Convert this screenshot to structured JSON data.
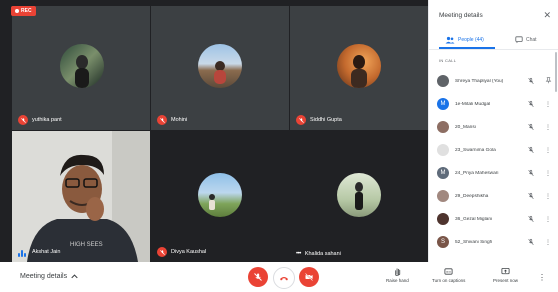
{
  "recording": {
    "label": "REC"
  },
  "tiles": [
    {
      "name": "yuthika pant"
    },
    {
      "name": "Mohini"
    },
    {
      "name": "Siddhi Gupta"
    },
    {
      "name": "Akshat Jain"
    },
    {
      "name": "Divya Kaushal"
    },
    {
      "name": "Khalida sahani"
    }
  ],
  "panel": {
    "title": "Meeting details",
    "tabs": {
      "people": "People (44)",
      "chat": "Chat"
    },
    "section_label": "IN CALL",
    "people": [
      {
        "name": "Shreya Thapliyal (You)",
        "initial": "",
        "color": "#5f6368"
      },
      {
        "name": "1e-Mitali Mudgal",
        "initial": "M",
        "color": "#1a73e8"
      },
      {
        "name": "20_Mansi",
        "initial": "",
        "color": "#8d6e63"
      },
      {
        "name": "23_Swarnima Gola",
        "initial": "",
        "color": "#e0e0e0"
      },
      {
        "name": "24_Priya Maheswari",
        "initial": "M",
        "color": "#5f6b7a"
      },
      {
        "name": "29_Deepshikha",
        "initial": "",
        "color": "#a1887f"
      },
      {
        "name": "36_Gezal Miglani",
        "initial": "",
        "color": "#4e342e"
      },
      {
        "name": "52_Shivani Singh",
        "initial": "S",
        "color": "#795548"
      }
    ]
  },
  "bottom": {
    "meeting_details": "Meeting details",
    "raise_hand": "Raise hand",
    "captions": "Turn on captions",
    "present": "Present now"
  },
  "colors": {
    "accent": "#1a73e8",
    "danger": "#ea4335",
    "grid_bg": "#202124"
  }
}
